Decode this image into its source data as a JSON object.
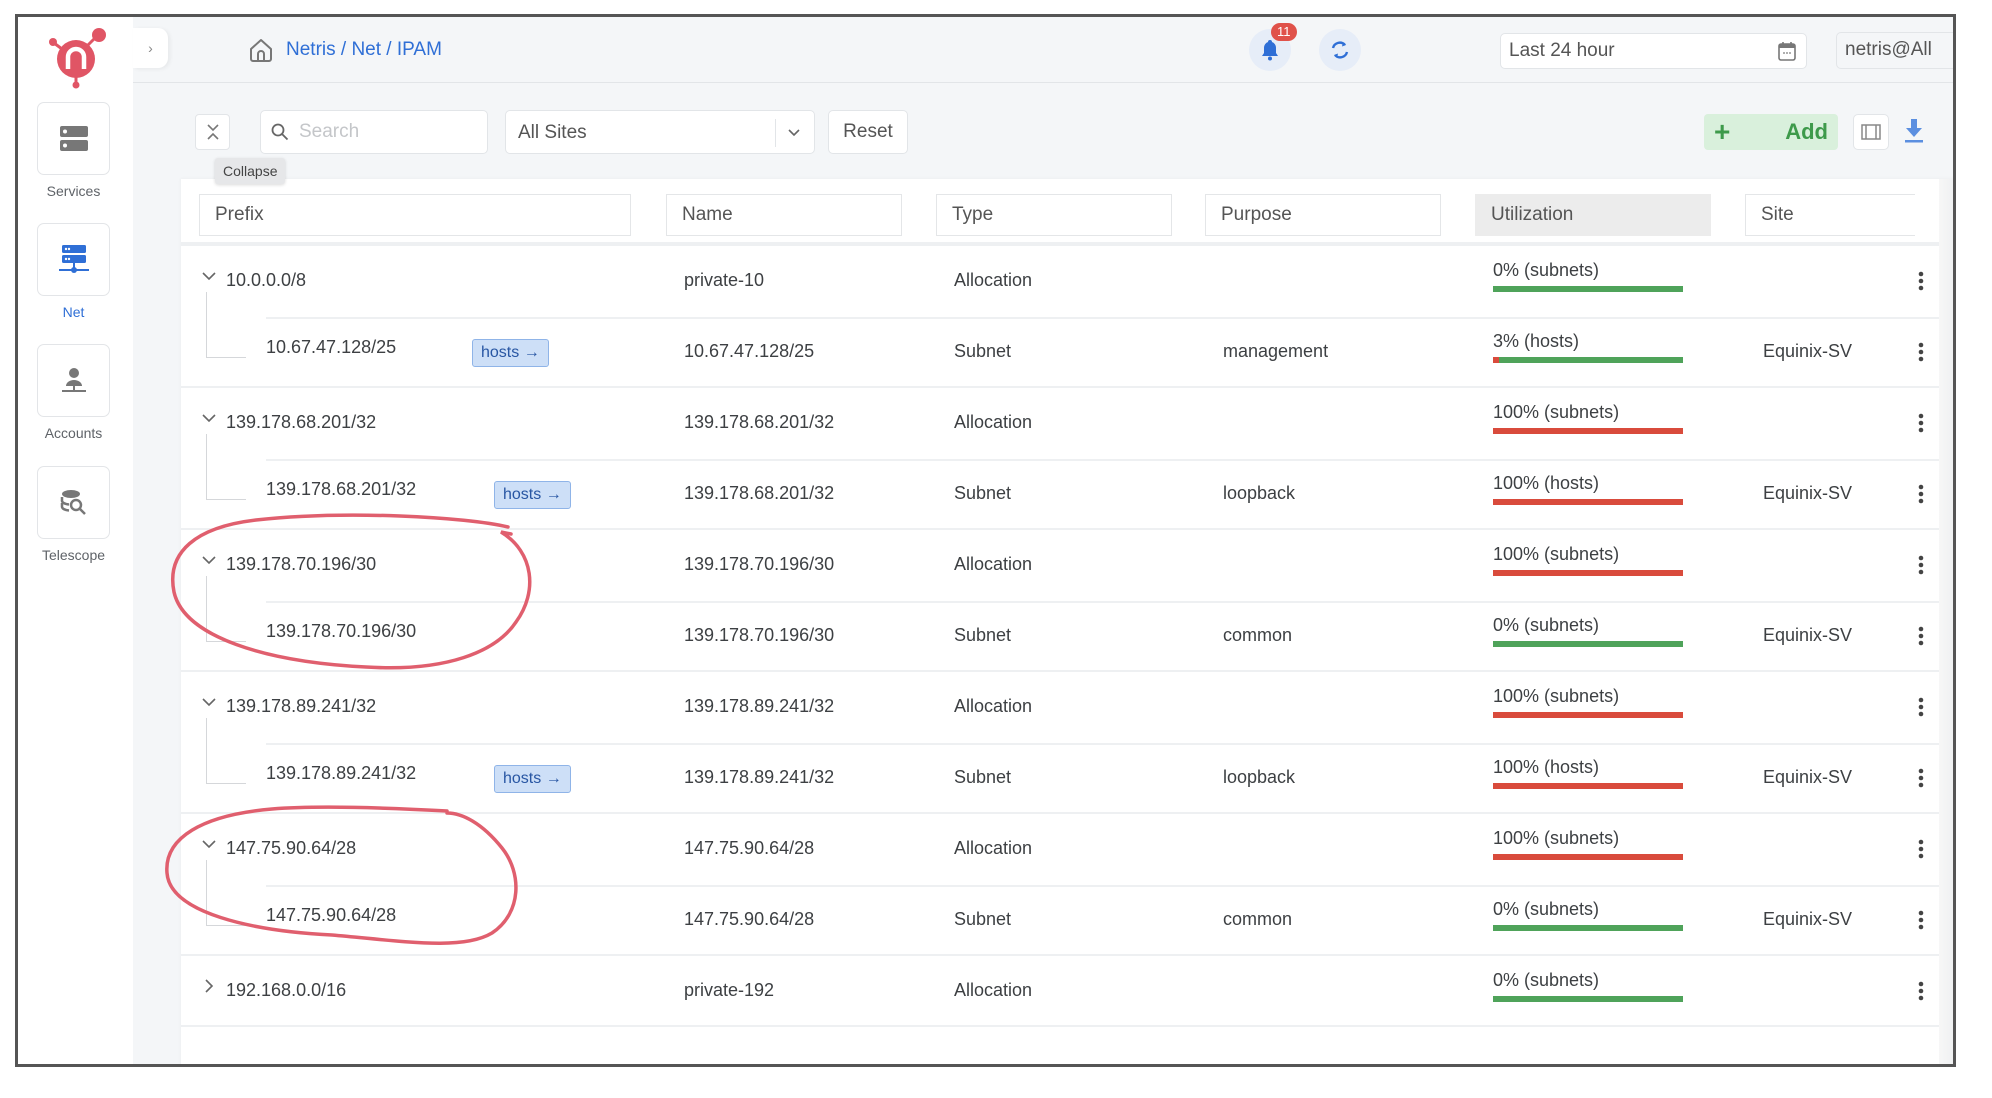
{
  "sidebar": {
    "items": [
      {
        "label": "Services",
        "icon": "services-icon",
        "active": false
      },
      {
        "label": "Net",
        "icon": "net-icon",
        "active": true
      },
      {
        "label": "Accounts",
        "icon": "accounts-icon",
        "active": false
      },
      {
        "label": "Telescope",
        "icon": "telescope-icon",
        "active": false
      }
    ],
    "expand_glyph": "›"
  },
  "header": {
    "breadcrumb": "Netris / Net / IPAM",
    "notifications_count": "11",
    "time_range": "Last 24 hour",
    "user_scope": "netris@All"
  },
  "toolbar": {
    "collapse_tooltip": "Collapse",
    "search_placeholder": "Search",
    "search_value": "",
    "sites_selected": "All Sites",
    "reset_label": "Reset",
    "add_label": "Add",
    "add_glyph": "+"
  },
  "table": {
    "columns": [
      "Prefix",
      "Name",
      "Type",
      "Purpose",
      "Utilization",
      "Site"
    ],
    "sorted_column": "Utilization",
    "hosts_label": "hosts →",
    "rows": [
      {
        "level": 0,
        "expanded": true,
        "prefix": "10.0.0.0/8",
        "name": "private-10",
        "type": "Allocation",
        "purpose": "",
        "util_text": "0% (subnets)",
        "util": 0,
        "site": "",
        "hosts": false
      },
      {
        "level": 1,
        "prefix": "10.67.47.128/25",
        "name": "10.67.47.128/25",
        "type": "Subnet",
        "purpose": "management",
        "util_text": "3% (hosts)",
        "util": 3,
        "site": "Equinix-SV",
        "hosts": true
      },
      {
        "level": 0,
        "expanded": true,
        "prefix": "139.178.68.201/32",
        "name": "139.178.68.201/32",
        "type": "Allocation",
        "purpose": "",
        "util_text": "100% (subnets)",
        "util": 100,
        "site": "",
        "hosts": false
      },
      {
        "level": 1,
        "prefix": "139.178.68.201/32",
        "name": "139.178.68.201/32",
        "type": "Subnet",
        "purpose": "loopback",
        "util_text": "100% (hosts)",
        "util": 100,
        "site": "Equinix-SV",
        "hosts": true
      },
      {
        "level": 0,
        "expanded": true,
        "prefix": "139.178.70.196/30",
        "name": "139.178.70.196/30",
        "type": "Allocation",
        "purpose": "",
        "util_text": "100% (subnets)",
        "util": 100,
        "site": "",
        "hosts": false
      },
      {
        "level": 1,
        "prefix": "139.178.70.196/30",
        "name": "139.178.70.196/30",
        "type": "Subnet",
        "purpose": "common",
        "util_text": "0% (subnets)",
        "util": 0,
        "site": "Equinix-SV",
        "hosts": false
      },
      {
        "level": 0,
        "expanded": true,
        "prefix": "139.178.89.241/32",
        "name": "139.178.89.241/32",
        "type": "Allocation",
        "purpose": "",
        "util_text": "100% (subnets)",
        "util": 100,
        "site": "",
        "hosts": false
      },
      {
        "level": 1,
        "prefix": "139.178.89.241/32",
        "name": "139.178.89.241/32",
        "type": "Subnet",
        "purpose": "loopback",
        "util_text": "100% (hosts)",
        "util": 100,
        "site": "Equinix-SV",
        "hosts": true
      },
      {
        "level": 0,
        "expanded": true,
        "prefix": "147.75.90.64/28",
        "name": "147.75.90.64/28",
        "type": "Allocation",
        "purpose": "",
        "util_text": "100% (subnets)",
        "util": 100,
        "site": "",
        "hosts": false
      },
      {
        "level": 1,
        "prefix": "147.75.90.64/28",
        "name": "147.75.90.64/28",
        "type": "Subnet",
        "purpose": "common",
        "util_text": "0% (subnets)",
        "util": 0,
        "site": "Equinix-SV",
        "hosts": false
      },
      {
        "level": 0,
        "expanded": false,
        "prefix": "192.168.0.0/16",
        "name": "private-192",
        "type": "Allocation",
        "purpose": "",
        "util_text": "0% (subnets)",
        "util": 0,
        "site": "",
        "hosts": false
      }
    ]
  },
  "colors": {
    "accent": "#2f6fd6",
    "util_used": "#d94b3c",
    "util_free": "#4fa35a",
    "annotation": "#e05f6e",
    "add_green": "#3e9a4b",
    "brand": "#e05565"
  },
  "annotations": [
    {
      "type": "hand-drawn-circle",
      "target_prefix": "139.178.70.196/30"
    },
    {
      "type": "hand-drawn-circle",
      "target_prefix": "147.75.90.64/28"
    }
  ]
}
